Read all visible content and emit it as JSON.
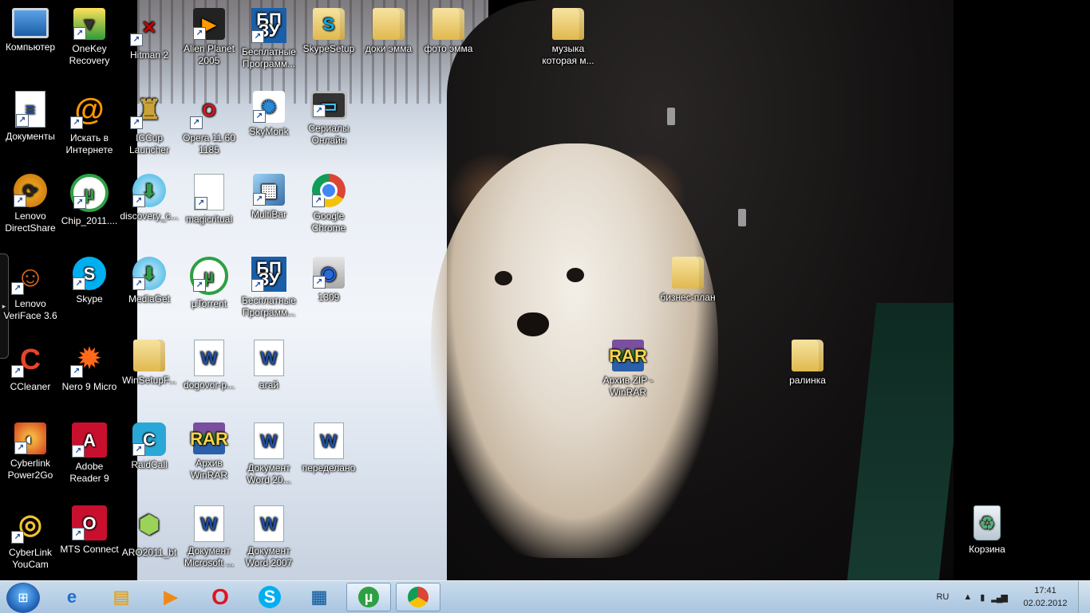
{
  "desktop": {
    "icons": [
      {
        "label": "Компьютер",
        "icon": "computer-icon"
      },
      {
        "label": "OneKey Recovery",
        "icon": "onekey-recovery-icon"
      },
      {
        "label": "Hitman 2",
        "icon": "hitman-icon"
      },
      {
        "label": "Alien Planet 2005",
        "icon": "video-file-icon"
      },
      {
        "label": "Бесплатные Программ...",
        "icon": "bp-icon"
      },
      {
        "label": "SkypeSetup",
        "icon": "installer-icon"
      },
      {
        "label": "доки эмма",
        "icon": "folder-icon"
      },
      {
        "label": "фото эмма",
        "icon": "folder-icon"
      },
      {
        "label": "музыка которая м...",
        "icon": "folder-icon"
      },
      {
        "label": "Документы",
        "icon": "documents-icon"
      },
      {
        "label": "Искать в Интернете",
        "icon": "web-search-icon"
      },
      {
        "label": "ICCup Launcher",
        "icon": "iccup-icon"
      },
      {
        "label": "Opera 11.60 1185",
        "icon": "opera-icon"
      },
      {
        "label": "SkyMonk",
        "icon": "skymonk-icon"
      },
      {
        "label": "Сериалы Онлайн",
        "icon": "tv-icon"
      },
      {
        "label": "Lenovo DirectShare",
        "icon": "lenovo-directshare-icon"
      },
      {
        "label": "Chip_2011....",
        "icon": "utorrent-icon"
      },
      {
        "label": "discovery_c...",
        "icon": "mediaget-icon"
      },
      {
        "label": "magicritual",
        "icon": "blank-file-icon"
      },
      {
        "label": "MultiBar",
        "icon": "multibar-icon"
      },
      {
        "label": "Google Chrome",
        "icon": "chrome-icon"
      },
      {
        "label": "Lenovo VeriFace 3.6",
        "icon": "veriface-icon"
      },
      {
        "label": "Skype",
        "icon": "skype-icon"
      },
      {
        "label": "MediaGet",
        "icon": "mediaget-icon"
      },
      {
        "label": "µTorrent",
        "icon": "utorrent-icon"
      },
      {
        "label": "Бесплатные Программ...",
        "icon": "bp-icon"
      },
      {
        "label": "1309",
        "icon": "setup-icon"
      },
      {
        "label": "бизнес-план",
        "icon": "folder-icon"
      },
      {
        "label": "CCleaner",
        "icon": "ccleaner-icon"
      },
      {
        "label": "Nero 9 Micro",
        "icon": "nero-icon"
      },
      {
        "label": "WinSetupF...",
        "icon": "folder-icon"
      },
      {
        "label": "dogovor-p...",
        "icon": "word-doc-icon"
      },
      {
        "label": "агай",
        "icon": "word-doc-icon"
      },
      {
        "label": "Архив ZIP - WinRAR",
        "icon": "winrar-icon"
      },
      {
        "label": "ралинка",
        "icon": "folder-icon"
      },
      {
        "label": "Cyberlink Power2Go",
        "icon": "power2go-icon"
      },
      {
        "label": "Adobe Reader 9",
        "icon": "adobe-reader-icon"
      },
      {
        "label": "RaidCall",
        "icon": "raidcall-icon"
      },
      {
        "label": "Архив WinRAR",
        "icon": "winrar-icon"
      },
      {
        "label": "Документ Word 20...",
        "icon": "word-doc-icon"
      },
      {
        "label": "переделано",
        "icon": "word-doc-icon"
      },
      {
        "label": "CyberLink YouCam",
        "icon": "youcam-icon"
      },
      {
        "label": "MTS Connect",
        "icon": "mts-icon"
      },
      {
        "label": "ARO2011_bt",
        "icon": "aro-icon"
      },
      {
        "label": "Документ Microsoft ...",
        "icon": "word-doc-icon"
      },
      {
        "label": "Документ Word 2007",
        "icon": "word-doc-icon"
      },
      {
        "label": "Корзина",
        "icon": "recycle-bin-icon"
      }
    ]
  },
  "taskbar": {
    "pinned": [
      {
        "name": "internet-explorer",
        "icon": "ie-icon"
      },
      {
        "name": "explorer",
        "icon": "folder-icon"
      },
      {
        "name": "media-player",
        "icon": "media-player-icon"
      },
      {
        "name": "opera",
        "icon": "opera-icon"
      },
      {
        "name": "skype",
        "icon": "skype-icon"
      },
      {
        "name": "multibar",
        "icon": "multibar-icon"
      },
      {
        "name": "utorrent",
        "icon": "utorrent-icon"
      },
      {
        "name": "chrome",
        "icon": "chrome-icon"
      }
    ],
    "tray": {
      "language": "RU",
      "time": "17:41",
      "date": "02.02.2012"
    }
  }
}
